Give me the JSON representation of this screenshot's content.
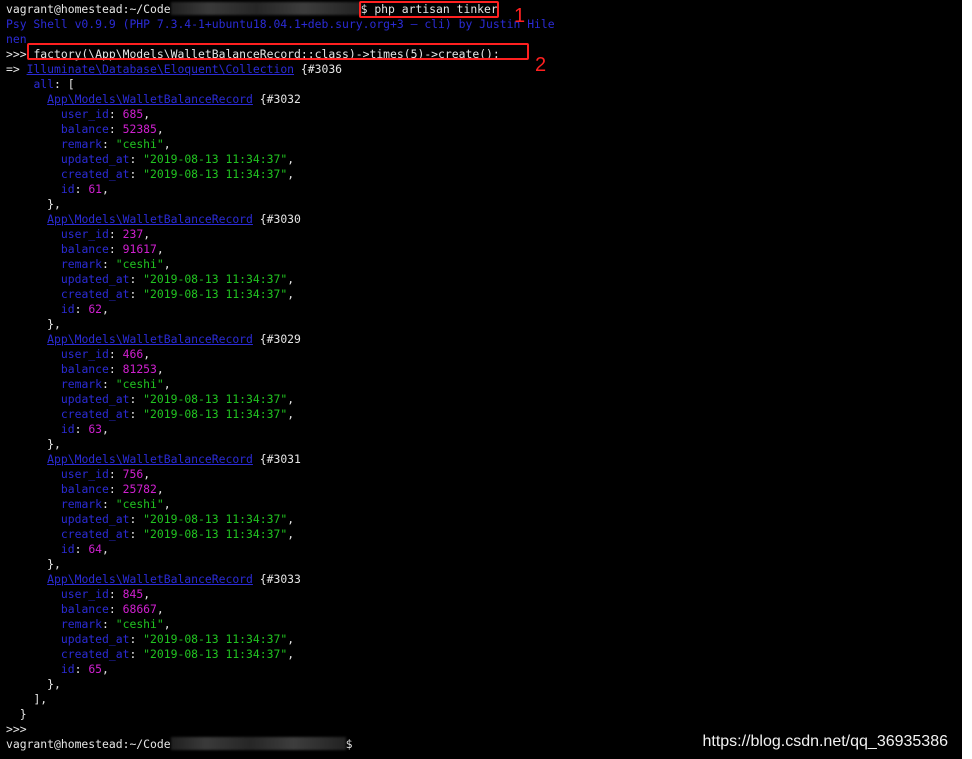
{
  "terminal": {
    "prompt_user": "vagrant@homestead:~/Code",
    "prompt_symbol": "$",
    "command1": "php artisan tinker",
    "psysh_banner_line1": "Psy Shell v0.9.9 (PHP 7.3.4-1+ubuntu18.04.1+deb.sury.org+3 — cli) by Justin Hile",
    "psysh_banner_line2": "nen",
    "repl_prompt": ">>>",
    "command2": "factory(\\App\\Models\\WalletBalanceRecord::class)->times(5)->create();",
    "result_arrow": "=>",
    "collection_class": "Illuminate\\Database\\Eloquent\\Collection",
    "collection_ref": "{#3036",
    "all_label": "all",
    "all_open": ": [",
    "record_class": "App\\Models\\WalletBalanceRecord",
    "records": [
      {
        "ref": "{#3032",
        "user_id": "685",
        "balance": "52385",
        "remark": "\"ceshi\"",
        "updated_at": "\"2019-08-13 11:34:37\"",
        "created_at": "\"2019-08-13 11:34:37\"",
        "id": "61"
      },
      {
        "ref": "{#3030",
        "user_id": "237",
        "balance": "91617",
        "remark": "\"ceshi\"",
        "updated_at": "\"2019-08-13 11:34:37\"",
        "created_at": "\"2019-08-13 11:34:37\"",
        "id": "62"
      },
      {
        "ref": "{#3029",
        "user_id": "466",
        "balance": "81253",
        "remark": "\"ceshi\"",
        "updated_at": "\"2019-08-13 11:34:37\"",
        "created_at": "\"2019-08-13 11:34:37\"",
        "id": "63"
      },
      {
        "ref": "{#3031",
        "user_id": "756",
        "balance": "25782",
        "remark": "\"ceshi\"",
        "updated_at": "\"2019-08-13 11:34:37\"",
        "created_at": "\"2019-08-13 11:34:37\"",
        "id": "64"
      },
      {
        "ref": "{#3033",
        "user_id": "845",
        "balance": "68667",
        "remark": "\"ceshi\"",
        "updated_at": "\"2019-08-13 11:34:37\"",
        "created_at": "\"2019-08-13 11:34:37\"",
        "id": "65"
      }
    ],
    "field_labels": {
      "user_id": "user_id",
      "balance": "balance",
      "remark": "remark",
      "updated_at": "updated_at",
      "created_at": "created_at",
      "id": "id"
    },
    "close_record": "},",
    "close_array": "],",
    "close_collection": "}",
    "final_prompt_user": "vagrant@homestead:~/Code"
  },
  "annotations": {
    "label1": "1",
    "label2": "2",
    "color": "#ff2020"
  },
  "watermark": "https://blog.csdn.net/qq_36935386"
}
